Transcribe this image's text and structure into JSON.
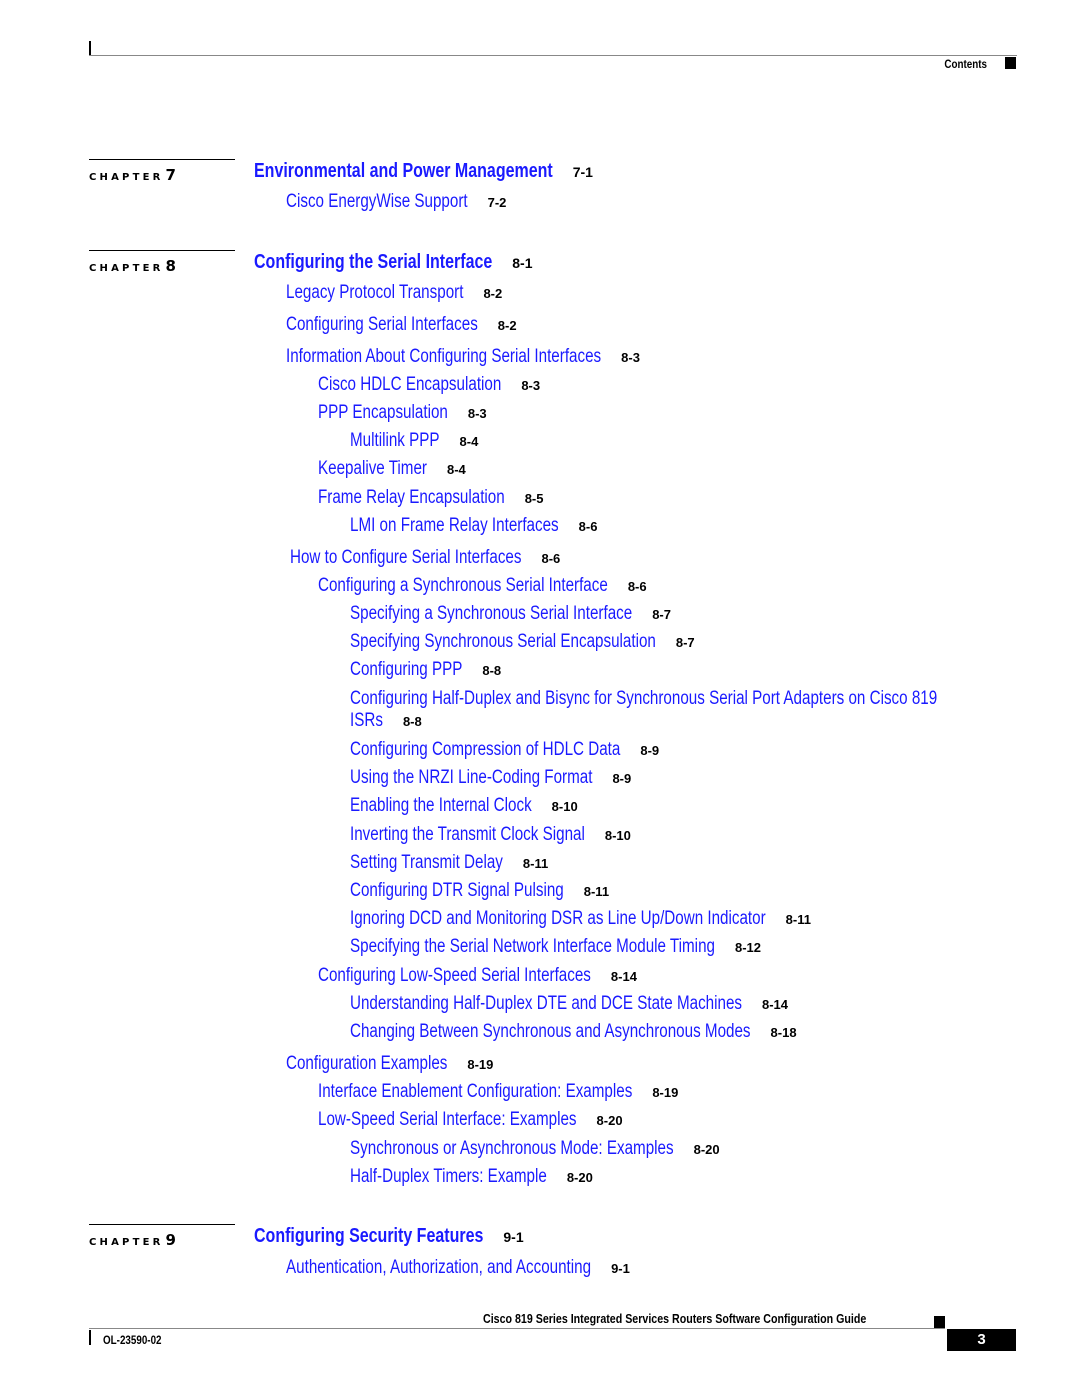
{
  "header": {
    "section": "Contents"
  },
  "chapters": [
    {
      "label": "CHAPTER",
      "number": "7",
      "title": "Environmental and Power Management",
      "page": "7-1",
      "entries": [
        {
          "level": 1,
          "text": "Cisco EnergyWise Support",
          "page": "7-2"
        }
      ]
    },
    {
      "label": "CHAPTER",
      "number": "8",
      "title": "Configuring the Serial Interface",
      "page": "8-1",
      "entries": [
        {
          "level": 1,
          "text": "Legacy Protocol Transport",
          "page": "8-2"
        },
        {
          "level": 1,
          "text": "Configuring Serial Interfaces",
          "page": "8-2"
        },
        {
          "level": 1,
          "text": "Information About Configuring Serial Interfaces",
          "page": "8-3"
        },
        {
          "level": 2,
          "text": "Cisco HDLC Encapsulation",
          "page": "8-3"
        },
        {
          "level": 2,
          "text": "PPP Encapsulation",
          "page": "8-3"
        },
        {
          "level": 3,
          "text": "Multilink PPP",
          "page": "8-4"
        },
        {
          "level": 2,
          "text": "Keepalive Timer",
          "page": "8-4"
        },
        {
          "level": 2,
          "text": "Frame Relay Encapsulation",
          "page": "8-5"
        },
        {
          "level": 3,
          "text": "LMI on Frame Relay Interfaces",
          "page": "8-6"
        },
        {
          "level": 1,
          "text": "How to Configure Serial Interfaces",
          "page": "8-6"
        },
        {
          "level": 2,
          "text": "Configuring a Synchronous Serial Interface",
          "page": "8-6"
        },
        {
          "level": 3,
          "text": "Specifying a Synchronous Serial Interface",
          "page": "8-7"
        },
        {
          "level": 3,
          "text": "Specifying Synchronous Serial Encapsulation",
          "page": "8-7"
        },
        {
          "level": 3,
          "text": "Configuring PPP",
          "page": "8-8"
        },
        {
          "level": 3,
          "text": "Configuring Half-Duplex and Bisync for Synchronous Serial Port Adapters on Cisco 819",
          "text2": "ISRs",
          "page": "8-8"
        },
        {
          "level": 3,
          "text": "Configuring Compression of HDLC Data",
          "page": "8-9"
        },
        {
          "level": 3,
          "text": "Using the NRZI Line-Coding Format",
          "page": "8-9"
        },
        {
          "level": 3,
          "text": "Enabling the Internal Clock",
          "page": "8-10"
        },
        {
          "level": 3,
          "text": "Inverting the Transmit Clock Signal",
          "page": "8-10"
        },
        {
          "level": 3,
          "text": "Setting Transmit Delay",
          "page": "8-11"
        },
        {
          "level": 3,
          "text": "Configuring DTR Signal Pulsing",
          "page": "8-11"
        },
        {
          "level": 3,
          "text": "Ignoring DCD and Monitoring DSR as Line Up/Down Indicator",
          "page": "8-11"
        },
        {
          "level": 3,
          "text": "Specifying the Serial Network Interface Module Timing",
          "page": "8-12"
        },
        {
          "level": 2,
          "text": "Configuring Low-Speed Serial Interfaces",
          "page": "8-14"
        },
        {
          "level": 3,
          "text": "Understanding Half-Duplex DTE and DCE State Machines",
          "page": "8-14"
        },
        {
          "level": 3,
          "text": "Changing Between Synchronous and Asynchronous Modes",
          "page": "8-18"
        },
        {
          "level": 1,
          "text": "Configuration Examples",
          "page": "8-19"
        },
        {
          "level": 2,
          "text": "Interface Enablement Configuration: Examples",
          "page": "8-19"
        },
        {
          "level": 2,
          "text": "Low-Speed Serial Interface: Examples",
          "page": "8-20"
        },
        {
          "level": 3,
          "text": "Synchronous or Asynchronous Mode: Examples",
          "page": "8-20"
        },
        {
          "level": 3,
          "text": "Half-Duplex Timers: Example",
          "page": "8-20"
        }
      ]
    },
    {
      "label": "CHAPTER",
      "number": "9",
      "title": "Configuring Security Features",
      "page": "9-1",
      "entries": [
        {
          "level": 1,
          "text": "Authentication, Authorization, and Accounting",
          "page": "9-1"
        }
      ]
    }
  ],
  "footer": {
    "book_title": "Cisco 819 Series Integrated Services Routers Software Configuration Guide",
    "doc_number": "OL-23590-02",
    "page_number": "3"
  },
  "colors": {
    "link": "#1a1aff",
    "text": "#000000"
  }
}
